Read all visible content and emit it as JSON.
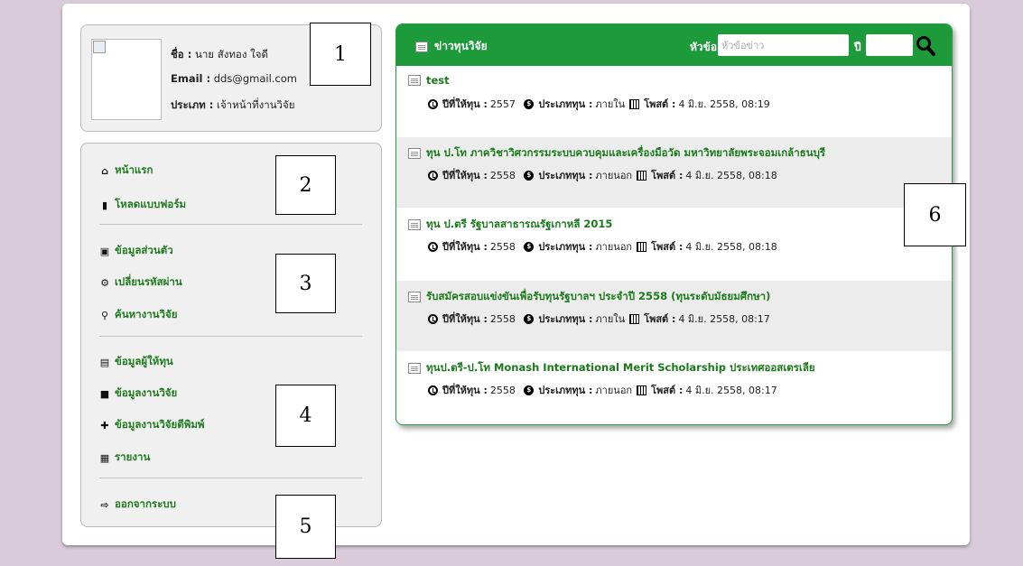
{
  "profile": {
    "name_label": "ชื่อ :",
    "name_value": "นาย สังทอง ใจดี",
    "email_label": "Email :",
    "email_value": "dds@gmail.com",
    "type_label": "ประเภท :",
    "type_value": "เจ้าหน้าที่งานวิจัย"
  },
  "menu": {
    "home": "หน้าแรก",
    "download_forms": "โหลดแบบฟอร์ม",
    "personal_info": "ข้อมูลส่วนตัว",
    "change_password": "เปลี่ยนรหัสผ่าน",
    "search_research": "ค้นหางานวิจัย",
    "funder_info": "ข้อมูลผู้ให้ทุน",
    "research_info": "ข้อมูลงานวิจัย",
    "published_research": "ข้อมูลงานวิจัยตีพิมพ์",
    "report": "รายงาน",
    "logout": "ออกจากระบบ"
  },
  "callouts": [
    "1",
    "2",
    "3",
    "4",
    "5",
    "6"
  ],
  "news": {
    "header_title": "ข่าวทุนวิจัย",
    "topic_label": "หัวข้อ",
    "topic_placeholder": "หัวข้อข่าว",
    "year_label": "ปี",
    "year_value": "",
    "items": [
      {
        "title": "test",
        "year_label": "ปีที่ให้ทุน :",
        "year": "2557",
        "type_label": "ประเภททุน :",
        "type": "ภายใน",
        "posted_label": "โพสต์ :",
        "posted": "4 มิ.ย. 2558, 08:19"
      },
      {
        "title": "ทุน ป.โท ภาควิชาวิศวกรรมระบบควบคุมและเครื่องมือวัด มหาวิทยาลัยพระจอมเกล้าธนบุรี",
        "year_label": "ปีที่ให้ทุน :",
        "year": "2558",
        "type_label": "ประเภททุน :",
        "type": "ภายนอก",
        "posted_label": "โพสต์ :",
        "posted": "4 มิ.ย. 2558, 08:18"
      },
      {
        "title": "ทุน ป.ตรี รัฐบาลสาธารณรัฐเกาหลี 2015",
        "year_label": "ปีที่ให้ทุน :",
        "year": "2558",
        "type_label": "ประเภททุน :",
        "type": "ภายนอก",
        "posted_label": "โพสต์ :",
        "posted": "4 มิ.ย. 2558, 08:18"
      },
      {
        "title": "รับสมัครสอบแข่งขันเพื่อรับทุนรัฐบาลฯ ประจำปี 2558 (ทุนระดับมัธยมศึกษา)",
        "year_label": "ปีที่ให้ทุน :",
        "year": "2558",
        "type_label": "ประเภททุน :",
        "type": "ภายใน",
        "posted_label": "โพสต์ :",
        "posted": "4 มิ.ย. 2558, 08:17"
      },
      {
        "title": "ทุนป.ตรี-ป.โท Monash International Merit Scholarship ประเทศออสเตรเลีย",
        "year_label": "ปีที่ให้ทุน :",
        "year": "2558",
        "type_label": "ประเภททุน :",
        "type": "ภายนอก",
        "posted_label": "โพสต์ :",
        "posted": "4 มิ.ย. 2558, 08:17"
      }
    ]
  },
  "colors": {
    "accent": "#1d9a3a",
    "link": "#1a7a1a",
    "background": "#d9cbd9"
  }
}
